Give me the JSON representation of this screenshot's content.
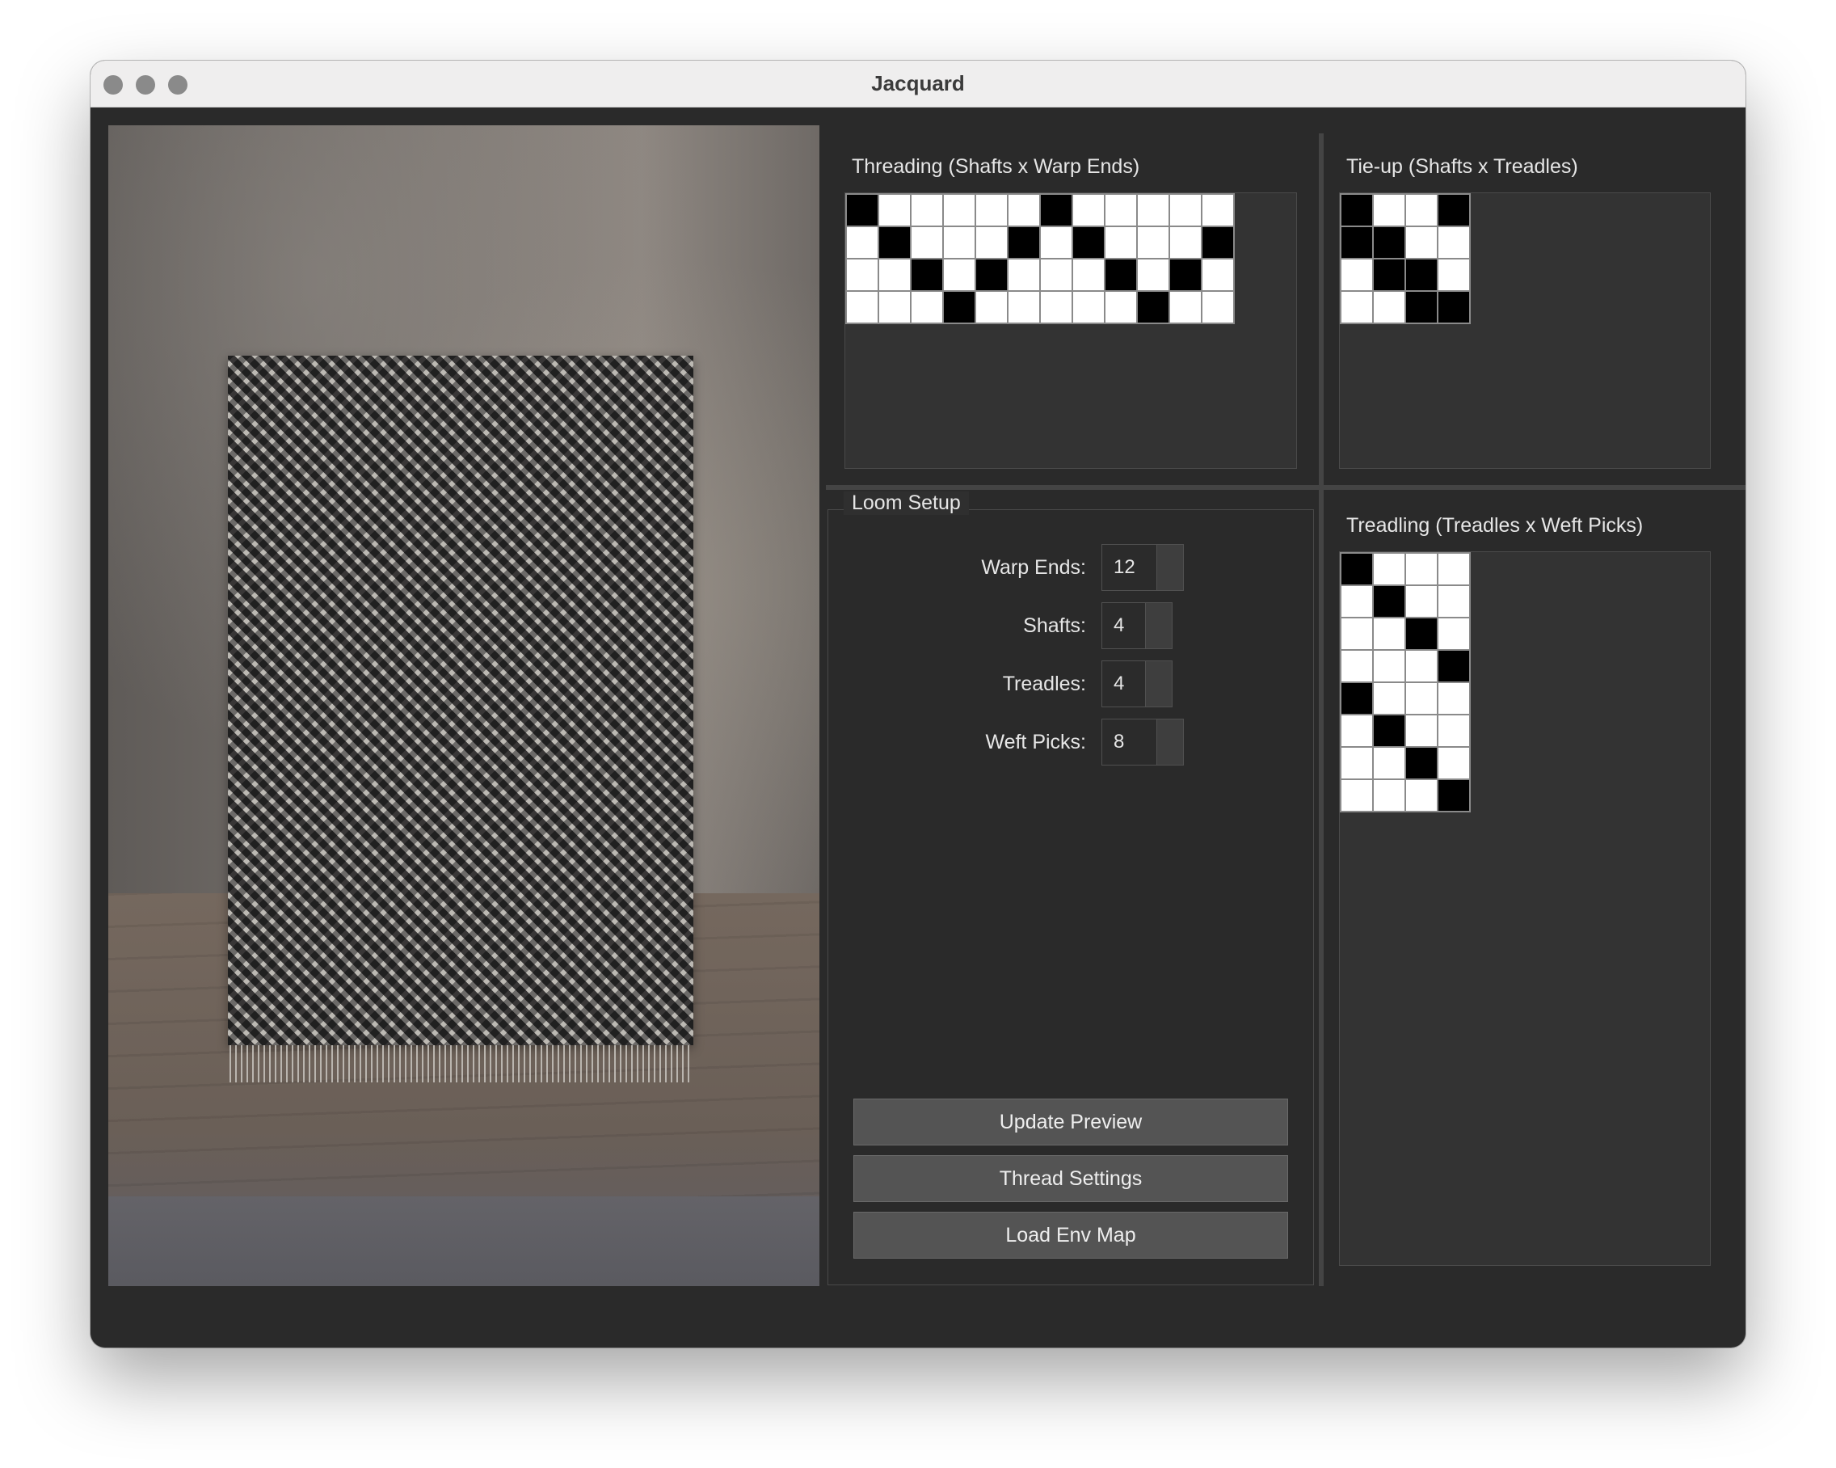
{
  "window": {
    "title": "Jacquard"
  },
  "threading": {
    "title": "Threading (Shafts x Warp Ends)",
    "rows": 4,
    "cols": 12,
    "cells": [
      [
        1,
        0,
        0,
        0,
        0,
        0,
        1,
        0,
        0,
        0,
        0,
        0
      ],
      [
        0,
        1,
        0,
        0,
        0,
        1,
        0,
        1,
        0,
        0,
        0,
        1
      ],
      [
        0,
        0,
        1,
        0,
        1,
        0,
        0,
        0,
        1,
        0,
        1,
        0
      ],
      [
        0,
        0,
        0,
        1,
        0,
        0,
        0,
        0,
        0,
        1,
        0,
        0
      ]
    ]
  },
  "tieup": {
    "title": "Tie-up (Shafts x Treadles)",
    "rows": 4,
    "cols": 4,
    "cells": [
      [
        1,
        0,
        0,
        1
      ],
      [
        1,
        1,
        0,
        0
      ],
      [
        0,
        1,
        1,
        0
      ],
      [
        0,
        0,
        1,
        1
      ]
    ]
  },
  "treadling": {
    "title": "Treadling (Treadles x Weft Picks)",
    "rows": 8,
    "cols": 4,
    "cells": [
      [
        1,
        0,
        0,
        0
      ],
      [
        0,
        1,
        0,
        0
      ],
      [
        0,
        0,
        1,
        0
      ],
      [
        0,
        0,
        0,
        1
      ],
      [
        1,
        0,
        0,
        0
      ],
      [
        0,
        1,
        0,
        0
      ],
      [
        0,
        0,
        1,
        0
      ],
      [
        0,
        0,
        0,
        1
      ]
    ]
  },
  "loom_setup": {
    "title": "Loom Setup",
    "warp_ends_label": "Warp Ends:",
    "warp_ends": "12",
    "shafts_label": "Shafts:",
    "shafts": "4",
    "treadles_label": "Treadles:",
    "treadles": "4",
    "weft_picks_label": "Weft Picks:",
    "weft_picks": "8"
  },
  "buttons": {
    "update_preview": "Update Preview",
    "thread_settings": "Thread Settings",
    "load_env_map": "Load Env Map"
  },
  "colors": {
    "cell_on": "#000000",
    "cell_off": "#ffffff",
    "panel_bg": "#333333",
    "window_bg": "#2a2a2a"
  }
}
